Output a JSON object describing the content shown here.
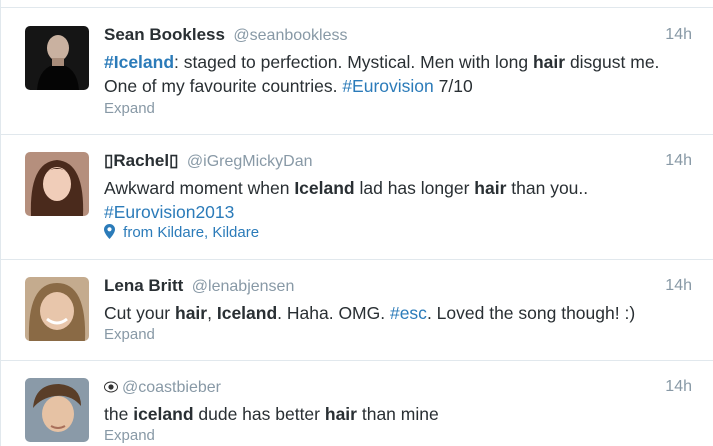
{
  "tweets": [
    {
      "name": "Sean Bookless",
      "handle": "@seanbookless",
      "time": "14h",
      "text": [
        {
          "t": "#Iceland",
          "s": "hashtag-bold"
        },
        {
          "t": ": staged to perfection. Mystical. Men with long ",
          "s": ""
        },
        {
          "t": "hair",
          "s": "bold"
        },
        {
          "t": " disgust me. One of my favourite countries. ",
          "s": ""
        },
        {
          "t": "#Eurovision",
          "s": "hashtag"
        },
        {
          "t": " 7/10",
          "s": ""
        }
      ],
      "expand": "Expand"
    },
    {
      "name": "▯Rachel▯",
      "handle": "@iGregMickyDan",
      "time": "14h",
      "text": [
        {
          "t": "Awkward moment when ",
          "s": ""
        },
        {
          "t": "Iceland",
          "s": "bold"
        },
        {
          "t": " lad has longer ",
          "s": ""
        },
        {
          "t": "hair",
          "s": "bold"
        },
        {
          "t": " than you.. ",
          "s": ""
        },
        {
          "t": "#Eurovision2013",
          "s": "hashtag"
        }
      ],
      "place": "from Kildare, Kildare",
      "place_icon": "map-pin-icon"
    },
    {
      "name": "Lena Britt",
      "handle": "@lenabjensen",
      "time": "14h",
      "text": [
        {
          "t": "Cut your ",
          "s": ""
        },
        {
          "t": "hair",
          "s": "bold"
        },
        {
          "t": ", ",
          "s": ""
        },
        {
          "t": "Iceland",
          "s": "bold"
        },
        {
          "t": ". Haha. OMG. ",
          "s": ""
        },
        {
          "t": "#esc",
          "s": "hashtag"
        },
        {
          "t": ". Loved the song though! :)",
          "s": ""
        }
      ],
      "expand": "Expand"
    },
    {
      "name": "",
      "handle": "@coastbieber",
      "time": "14h",
      "text": [
        {
          "t": "the ",
          "s": ""
        },
        {
          "t": "iceland",
          "s": "bold"
        },
        {
          "t": " dude has better ",
          "s": ""
        },
        {
          "t": "hair",
          "s": "bold"
        },
        {
          "t": " than mine",
          "s": ""
        }
      ],
      "expand": "Expand"
    }
  ],
  "colors": {
    "hashtag": "#2b7bb9",
    "muted": "#8899a6",
    "text": "#292f33",
    "border": "#e1e8ed"
  }
}
